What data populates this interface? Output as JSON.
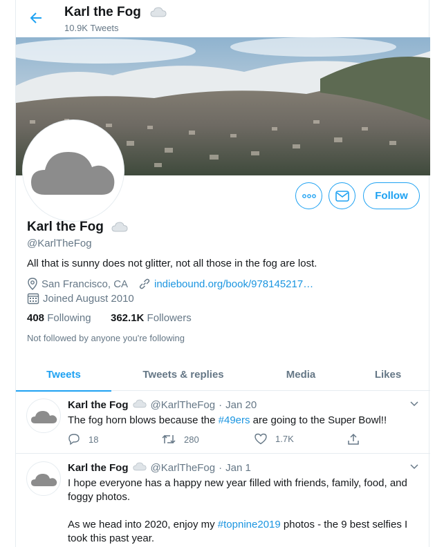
{
  "header": {
    "name": "Karl the Fog",
    "tweet_count": "10.9K Tweets"
  },
  "profile": {
    "name": "Karl the Fog",
    "handle": "@KarlTheFog",
    "bio": "All that is sunny does not glitter, not all those in the fog are lost.",
    "location": "San Francisco, CA",
    "link": "indiebound.org/book/978145217…",
    "joined": "Joined August 2010",
    "following_count": "408",
    "following_label": "Following",
    "followers_count": "362.1K",
    "followers_label": "Followers",
    "not_followed": "Not followed by anyone you're following"
  },
  "actions": {
    "follow_label": "Follow"
  },
  "tabs": [
    {
      "label": "Tweets",
      "active": true
    },
    {
      "label": "Tweets & replies",
      "active": false
    },
    {
      "label": "Media",
      "active": false
    },
    {
      "label": "Likes",
      "active": false
    }
  ],
  "tweets": [
    {
      "name": "Karl the Fog",
      "handle": "@KarlTheFog",
      "date": "Jan 20",
      "text_before": "The fog horn blows because the ",
      "hashtag": "#49ers",
      "text_after": " are going to the Super Bowl!!",
      "replies": "18",
      "retweets": "280",
      "likes": "1.7K"
    },
    {
      "name": "Karl the Fog",
      "handle": "@KarlTheFog",
      "date": "Jan 1",
      "text_line1": "I hope everyone has a happy new year filled with friends, family, food, and foggy photos.",
      "text_before": "As we head into 2020, enjoy my ",
      "hashtag": "#topnine2019",
      "text_after": " photos - the 9 best selfies I took this past year."
    }
  ],
  "colors": {
    "accent": "#1da1f2",
    "link": "#1b95e0",
    "muted": "#657786",
    "border": "#e6ecf0"
  }
}
